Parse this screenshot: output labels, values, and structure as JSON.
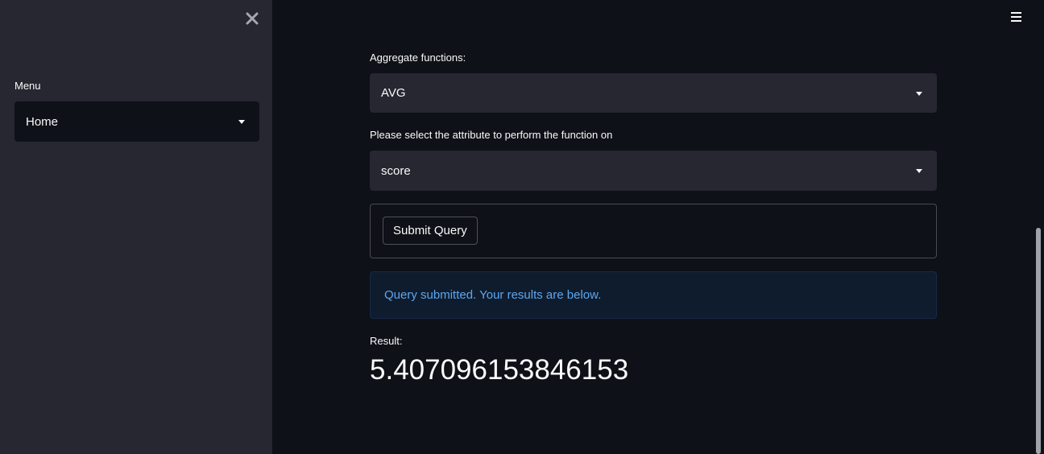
{
  "sidebar": {
    "menu_label": "Menu",
    "menu_selected": "Home"
  },
  "main": {
    "aggregate_label": "Aggregate functions:",
    "aggregate_selected": "AVG",
    "attribute_label": "Please select the attribute to perform the function on",
    "attribute_selected": "score",
    "submit_label": "Submit Query",
    "info_message": "Query submitted. Your results are below.",
    "result_label": "Result:",
    "result_value": "5.407096153846153"
  },
  "icons": {
    "close": "close-icon",
    "hamburger": "hamburger-menu-icon",
    "caret": "chevron-down-icon"
  },
  "colors": {
    "background": "#0e1117",
    "sidebar": "#262730",
    "info_text": "#5da7ee",
    "info_bg": "#0f1c2e"
  }
}
